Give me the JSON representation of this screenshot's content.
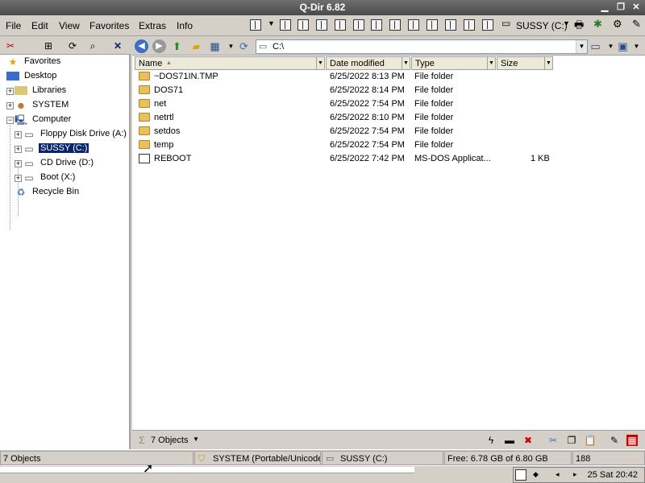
{
  "window": {
    "title": "Q-Dir 6.82"
  },
  "menu": [
    "File",
    "Edit",
    "View",
    "Favorites",
    "Extras",
    "Info"
  ],
  "toolbar": {
    "drive_label": "SUSSY (C:)"
  },
  "tree": [
    {
      "label": "Favorites",
      "icon": "star-icon"
    },
    {
      "label": "Desktop",
      "icon": "desktop-icon"
    },
    {
      "label": "Libraries",
      "icon": "libraries-icon"
    },
    {
      "label": "SYSTEM",
      "icon": "user-folder-icon"
    },
    {
      "label": "Computer",
      "icon": "computer-icon"
    },
    {
      "label": "Floppy Disk Drive (A:)",
      "icon": "floppy-drive-icon"
    },
    {
      "label": "SUSSY (C:)",
      "icon": "hard-drive-icon"
    },
    {
      "label": "CD Drive (D:)",
      "icon": "cd-drive-icon"
    },
    {
      "label": "Boot (X:)",
      "icon": "hard-drive-icon"
    },
    {
      "label": "Recycle Bin",
      "icon": "recycle-bin-icon"
    }
  ],
  "address": {
    "value": "C:\\"
  },
  "columns": {
    "name": "Name",
    "date": "Date modified",
    "type": "Type",
    "size": "Size"
  },
  "files": [
    {
      "name": "~DOS71IN.TMP",
      "date": "6/25/2022 8:13 PM",
      "type": "File folder",
      "size": ""
    },
    {
      "name": "DOS71",
      "date": "6/25/2022 8:14 PM",
      "type": "File folder",
      "size": ""
    },
    {
      "name": "net",
      "date": "6/25/2022 7:54 PM",
      "type": "File folder",
      "size": ""
    },
    {
      "name": "netrtl",
      "date": "6/25/2022 8:10 PM",
      "type": "File folder",
      "size": ""
    },
    {
      "name": "setdos",
      "date": "6/25/2022 7:54 PM",
      "type": "File folder",
      "size": ""
    },
    {
      "name": "temp",
      "date": "6/25/2022 7:54 PM",
      "type": "File folder",
      "size": ""
    },
    {
      "name": "REBOOT",
      "date": "6/25/2022 7:42 PM",
      "type": "MS-DOS Applicat...",
      "size": "1 KB"
    }
  ],
  "pane_footer": {
    "count": "7 Objects"
  },
  "statusbar": {
    "objects": "7 Objects",
    "user": "SYSTEM (Portable/Unicode)",
    "drive": "SUSSY (C:)",
    "free": "Free: 6.78 GB of 6.80 GB",
    "number": "188"
  },
  "taskbar": {
    "clock": "25 Sat 20:42"
  }
}
